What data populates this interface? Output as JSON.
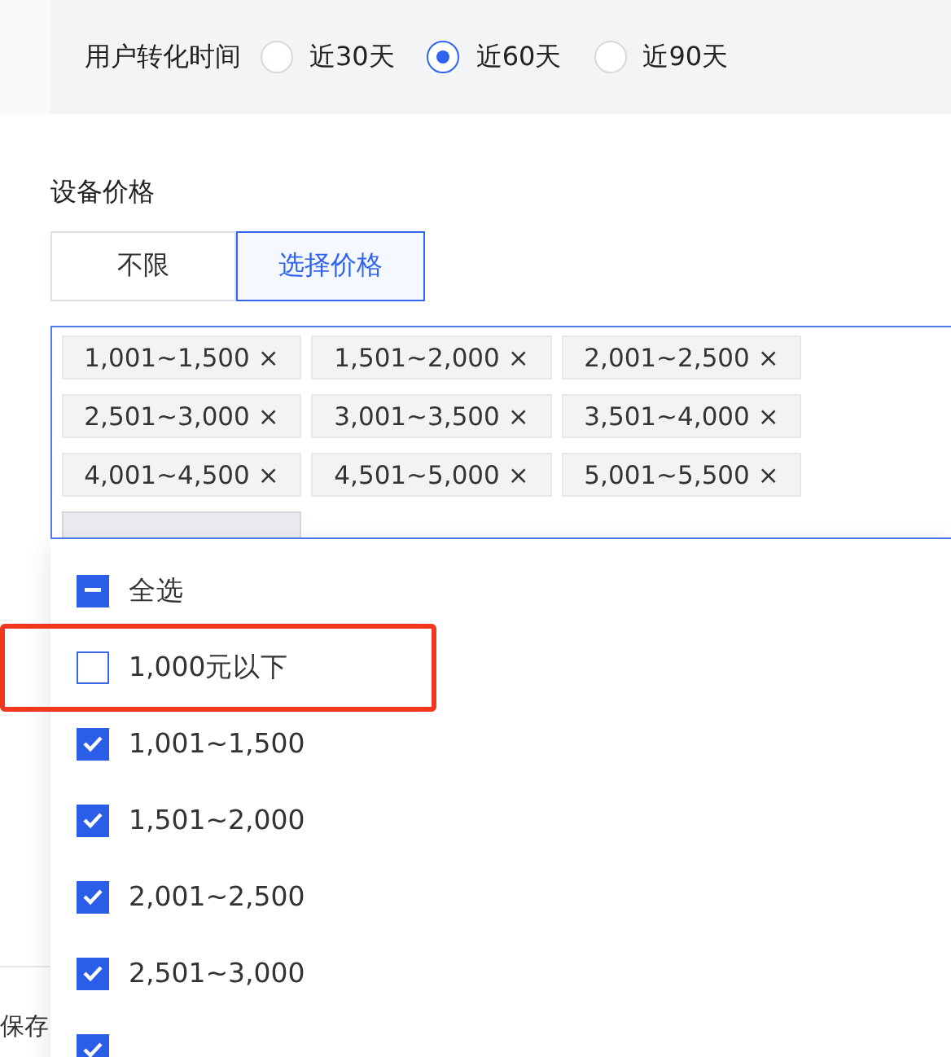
{
  "conversion_time": {
    "label": "用户转化时间",
    "options": [
      {
        "label": "近30天",
        "selected": false
      },
      {
        "label": "近60天",
        "selected": true
      },
      {
        "label": "近90天",
        "selected": false
      }
    ]
  },
  "device_price": {
    "label": "设备价格",
    "modes": [
      {
        "label": "不限",
        "selected": false
      },
      {
        "label": "选择价格",
        "selected": true
      }
    ],
    "tags": [
      {
        "label": "1,001~1,500 ×"
      },
      {
        "label": "1,501~2,000 ×"
      },
      {
        "label": "2,001~2,500 ×"
      },
      {
        "label": "2,501~3,000 ×"
      },
      {
        "label": "3,001~3,500 ×"
      },
      {
        "label": "3,501~4,000 ×"
      },
      {
        "label": "4,001~4,500 ×"
      },
      {
        "label": "4,501~5,000 ×"
      },
      {
        "label": "5,001~5,500 ×"
      },
      {
        "kind": "cut"
      }
    ]
  },
  "dropdown": {
    "select_all": {
      "label": "全选",
      "indeterminate": true
    },
    "options": [
      {
        "label": "1,000元以下",
        "checked": false,
        "highlighted": true
      },
      {
        "label": "1,001~1,500",
        "checked": true,
        "highlighted": false
      },
      {
        "label": "1,501~2,000",
        "checked": true,
        "highlighted": false
      },
      {
        "label": "2,001~2,500",
        "checked": true,
        "highlighted": false
      },
      {
        "label": "2,501~3,000",
        "checked": true,
        "highlighted": false
      },
      {
        "checked": true,
        "highlighted": false
      }
    ]
  },
  "footer": {
    "button": "保存"
  }
}
